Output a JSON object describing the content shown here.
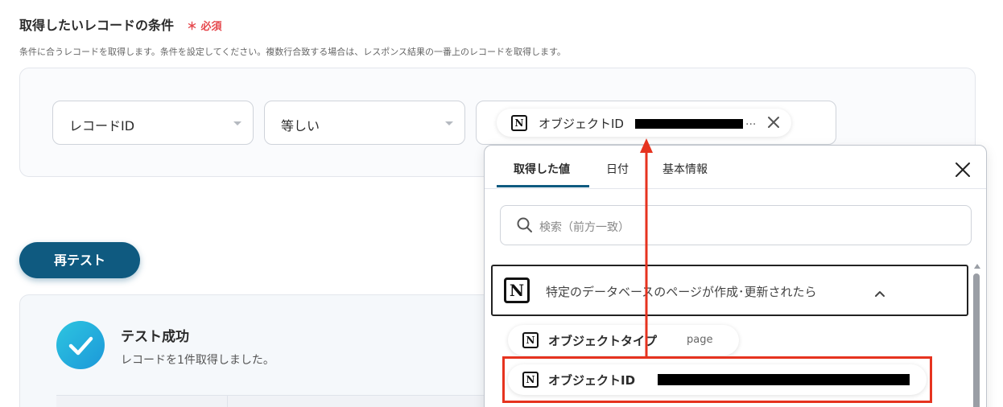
{
  "section": {
    "title": "取得したいレコードの条件",
    "required": "＊ 必須",
    "help": "条件に合うレコードを取得します。条件を設定してください。複数行合致する場合は、レスポンス結果の一番上のレコードを取得します。"
  },
  "condition": {
    "field": "レコードID",
    "operator": "等しい",
    "value_chip": {
      "label": "オブジェクトID",
      "ellipsis": "..."
    }
  },
  "retest_button": "再テスト",
  "result": {
    "title": "テスト成功",
    "description": "レコードを1件取得しました。"
  },
  "dropdown": {
    "tabs": [
      {
        "label": "取得した値",
        "active": true
      },
      {
        "label": "日付",
        "active": false
      },
      {
        "label": "基本情報",
        "active": false
      }
    ],
    "search_placeholder": "検索（前方一致）",
    "group": {
      "label": "特定のデータベースのページが作成･更新されたら",
      "expanded": true
    },
    "items": [
      {
        "label": "オブジェクトタイプ",
        "value": "page"
      },
      {
        "label": "オブジェクトID",
        "value_redacted": true
      }
    ]
  },
  "colors": {
    "primary": "#0f5a80",
    "required": "#e5484d",
    "highlight": "#e6331f",
    "success_gradient_start": "#2dc5e0",
    "success_gradient_end": "#1c98d9"
  }
}
